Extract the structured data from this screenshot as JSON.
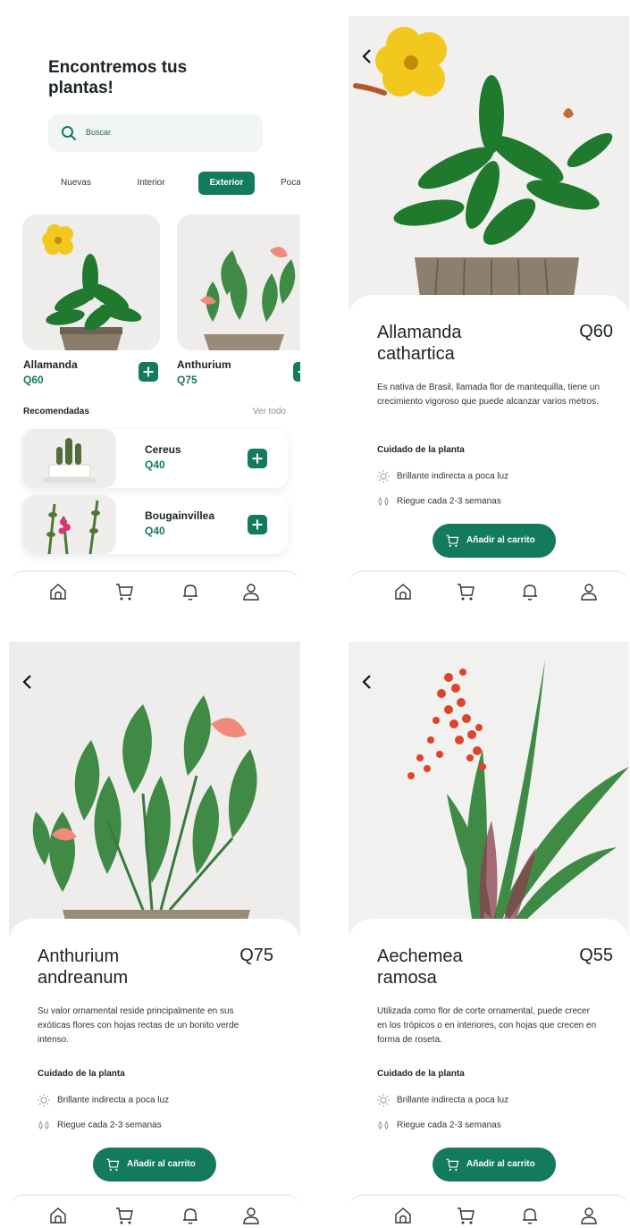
{
  "home": {
    "title": "Encontremos tus plantas!",
    "search_placeholder": "Buscar",
    "tabs": [
      "Nuevas",
      "Interior",
      "Exterior",
      "Poca"
    ],
    "active_tab": "Exterior",
    "featured": [
      {
        "name": "Allamanda",
        "price": "Q60"
      },
      {
        "name": "Anthurium",
        "price": "Q75"
      }
    ],
    "recommended_title": "Recomendadas",
    "see_all": "Ver todo",
    "recommended": [
      {
        "name": "Cereus",
        "price": "Q40"
      },
      {
        "name": "Bougainvillea",
        "price": "Q40"
      }
    ]
  },
  "details": [
    {
      "name": "Allamanda cathartica",
      "price": "Q60",
      "description": "Es nativa de Brasil, llamada flor de mantequilla, tiene un crecimiento vigoroso que puede alcanzar varios metros."
    },
    {
      "name": "Anthurium andreanum",
      "price": "Q75",
      "description": "Su valor ornamental reside principalmente en sus exóticas flores con hojas rectas de un bonito verde intenso."
    },
    {
      "name": "Aechemea ramosa",
      "price": "Q55",
      "description": "Utilizada como flor de corte ornamental, puede crecer en los trópicos o en interiores, con hojas que crecen en forma de roseta."
    }
  ],
  "care": {
    "title": "Cuidado de la planta",
    "light": "Brillante indirecta a poca luz",
    "water": "Riegue cada 2-3 semanas"
  },
  "cart_button": "Añadir al carrito",
  "icons": [
    "search-icon",
    "plus-icon",
    "home-icon",
    "cart-icon",
    "bell-icon",
    "user-icon",
    "back-icon",
    "sun-icon",
    "water-drops-icon"
  ],
  "colors": {
    "accent": "#137a5d",
    "text": "#1b2424",
    "search_bg": "#f1f5f4"
  }
}
